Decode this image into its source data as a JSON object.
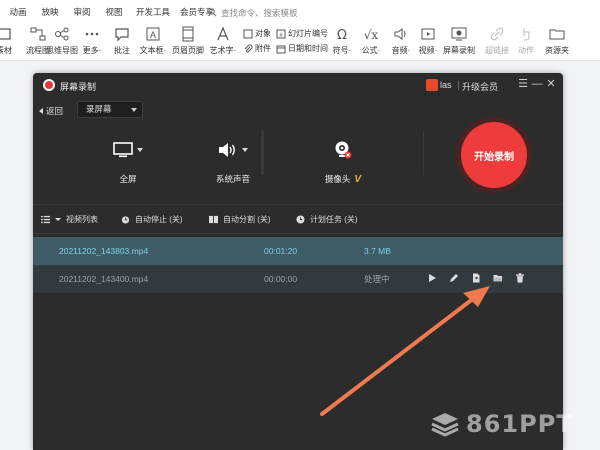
{
  "ribbon": {
    "tabs": [
      "动画",
      "放映",
      "审阅",
      "视图",
      "开发工具",
      "会员专享"
    ],
    "search_placeholder": "查找命令、搜索模板",
    "tools": [
      {
        "label": "素材",
        "icon": "material-icon"
      },
      {
        "label": "流程图",
        "icon": "flowchart-icon"
      },
      {
        "label": "思维导图",
        "icon": "mindmap-icon"
      },
      {
        "label": "更多·",
        "icon": "more-icon"
      },
      {
        "label": "批注",
        "icon": "comment-icon"
      },
      {
        "label": "文本框·",
        "icon": "textbox-icon"
      },
      {
        "label": "页眉页脚",
        "icon": "header-footer-icon"
      },
      {
        "label": "艺术字·",
        "icon": "wordart-icon"
      },
      {
        "label": "符号·",
        "icon": "symbol-icon"
      },
      {
        "label": "公式·",
        "icon": "formula-icon"
      },
      {
        "label": "音频·",
        "icon": "audio-icon"
      },
      {
        "label": "视频·",
        "icon": "video-icon"
      },
      {
        "label": "屏幕录制",
        "icon": "screen-record-icon"
      },
      {
        "label": "超链接",
        "icon": "hyperlink-icon"
      },
      {
        "label": "动作",
        "icon": "action-icon"
      },
      {
        "label": "资源夹",
        "icon": "resource-icon"
      }
    ],
    "mini_tools": [
      {
        "label": "对象",
        "icon": "object-icon"
      },
      {
        "label": "附件",
        "icon": "attachment-icon"
      },
      {
        "label": "幻灯片编号",
        "icon": "slide-number-icon"
      },
      {
        "label": "日期和时间",
        "icon": "date-time-icon"
      }
    ]
  },
  "recorder": {
    "title": "屏幕录制",
    "user_name": "las",
    "upgrade_label": "升级会员",
    "window_controls": {
      "menu": "☰",
      "minimize": "—",
      "close": "✕"
    },
    "back_label": "返回",
    "mode_select": "录屏幕",
    "sources": [
      {
        "label": "全屏",
        "icon": "monitor-icon"
      },
      {
        "label": "系统声音",
        "icon": "speaker-icon"
      },
      {
        "label": "摄像头",
        "icon": "webcam-icon",
        "badge": "V"
      }
    ],
    "start_label": "开始录制",
    "options": [
      {
        "label": "视频列表",
        "icon": "list-icon"
      },
      {
        "label": "自动停止 (关)",
        "icon": "stopwatch-icon"
      },
      {
        "label": "自动分割 (关)",
        "icon": "split-icon"
      },
      {
        "label": "计划任务 (关)",
        "icon": "clock-icon"
      }
    ],
    "files": [
      {
        "name": "20211202_143803.mp4",
        "duration": "00:01:20",
        "status": "3.7 MB"
      },
      {
        "name": "20211202_143400.mp4",
        "duration": "00:00:00",
        "status": "处理中"
      }
    ],
    "row_actions": [
      "play-icon",
      "edit-icon",
      "export-icon",
      "open-folder-icon",
      "delete-icon"
    ]
  },
  "watermark": {
    "text": "861PPT"
  },
  "colors": {
    "accent_red": "#ee3b3b",
    "highlight_row": "#3f5b66",
    "arrow": "#f07a50",
    "vip_gold": "#e8b23a"
  }
}
